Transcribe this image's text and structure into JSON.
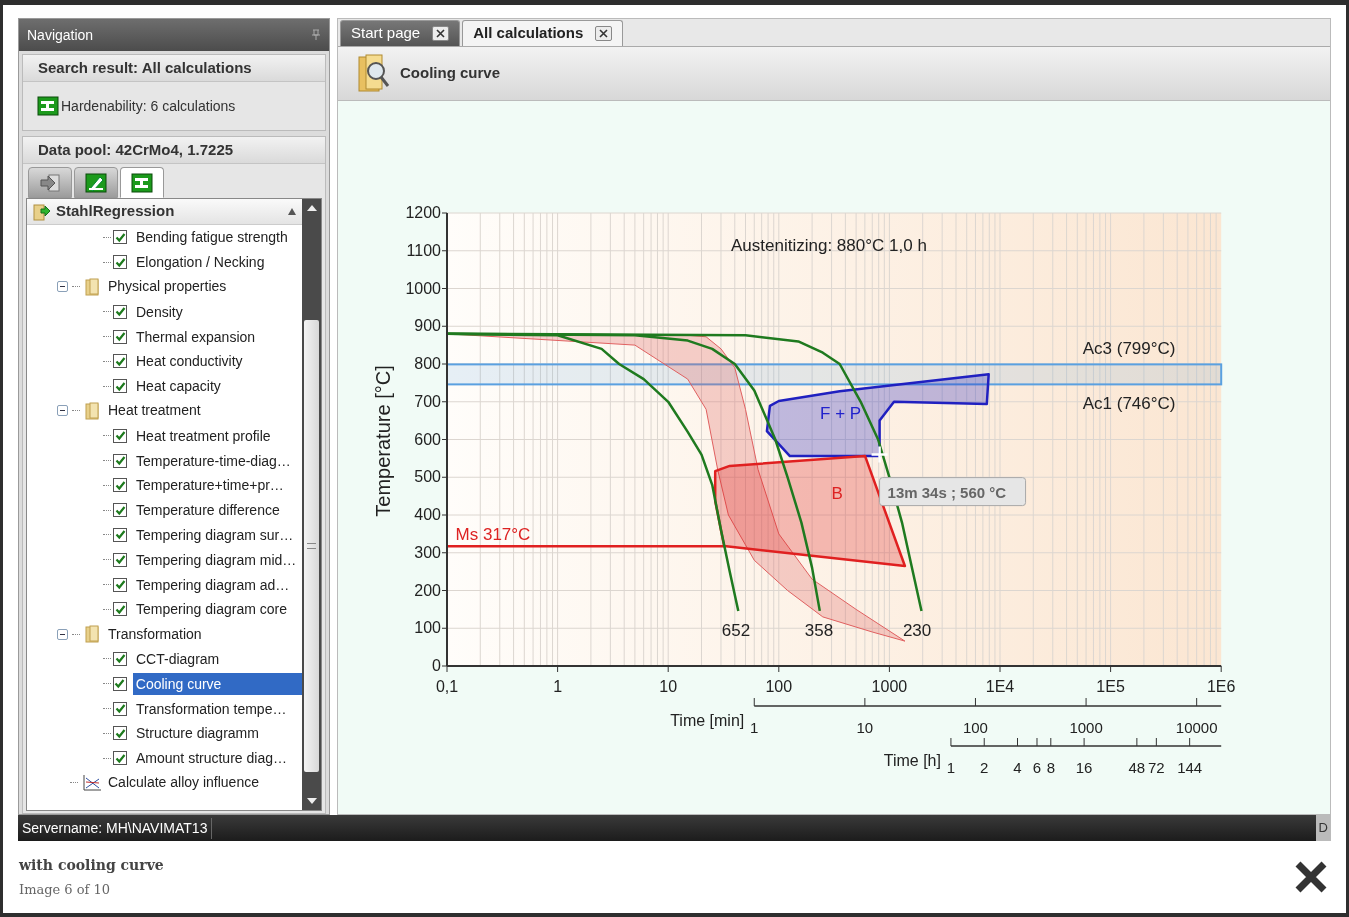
{
  "navigation": {
    "title": "Navigation",
    "search_result": {
      "title": "Search result: All calculations",
      "items": [
        {
          "label": "Hardenability: 6 calculations"
        }
      ]
    },
    "data_pool": {
      "title": "Data pool: 42CrMo4, 1.7225",
      "tabs": [
        {
          "kind": "import",
          "selected": false
        },
        {
          "kind": "edit",
          "selected": false
        },
        {
          "kind": "profile",
          "selected": true
        }
      ]
    },
    "tree": {
      "root": {
        "label": "StahlRegression",
        "expanded": true
      },
      "items": [
        {
          "kind": "group",
          "children": [
            {
              "kind": "check",
              "label": "Bending fatigue strength",
              "checked": true,
              "selected": false
            },
            {
              "kind": "check",
              "label": "Elongation / Necking",
              "checked": true,
              "selected": false
            }
          ]
        },
        {
          "kind": "folder",
          "label": "Physical properties",
          "expanded": true,
          "children": [
            {
              "kind": "check",
              "label": "Density",
              "checked": true,
              "selected": false
            },
            {
              "kind": "check",
              "label": "Thermal expansion",
              "checked": true,
              "selected": false
            },
            {
              "kind": "check",
              "label": "Heat conductivity",
              "checked": true,
              "selected": false
            },
            {
              "kind": "check",
              "label": "Heat capacity",
              "checked": true,
              "selected": false
            }
          ]
        },
        {
          "kind": "folder",
          "label": "Heat treatment",
          "expanded": true,
          "children": [
            {
              "kind": "check",
              "label": "Heat treatment profile",
              "checked": true,
              "selected": false
            },
            {
              "kind": "check",
              "label": "Temperature-time-diag…",
              "checked": true,
              "selected": false
            },
            {
              "kind": "check",
              "label": "Temperature+time+pr…",
              "checked": true,
              "selected": false
            },
            {
              "kind": "check",
              "label": "Temperature difference",
              "checked": true,
              "selected": false
            },
            {
              "kind": "check",
              "label": "Tempering diagram sur…",
              "checked": true,
              "selected": false
            },
            {
              "kind": "check",
              "label": "Tempering diagram mid…",
              "checked": true,
              "selected": false
            },
            {
              "kind": "check",
              "label": "Tempering diagram ad…",
              "checked": true,
              "selected": false
            },
            {
              "kind": "check",
              "label": "Tempering diagram core",
              "checked": true,
              "selected": false
            }
          ]
        },
        {
          "kind": "folder",
          "label": "Transformation",
          "expanded": true,
          "children": [
            {
              "kind": "check",
              "label": "CCT-diagram",
              "checked": true,
              "selected": false
            },
            {
              "kind": "check",
              "label": "Cooling curve",
              "checked": true,
              "selected": true
            },
            {
              "kind": "check",
              "label": "Transformation tempe…",
              "checked": true,
              "selected": false
            },
            {
              "kind": "check",
              "label": "Structure diagramm",
              "checked": true,
              "selected": false
            },
            {
              "kind": "check",
              "label": "Amount structure diag…",
              "checked": true,
              "selected": false
            }
          ]
        },
        {
          "kind": "action",
          "label": "Calculate alloy influence"
        }
      ]
    }
  },
  "tabs": [
    {
      "label": "Start page",
      "selected": false
    },
    {
      "label": "All calculations",
      "selected": true
    }
  ],
  "page_title": "Cooling curve",
  "diagram": {
    "ylabel": "Temperature [°C]",
    "yticks": [
      "1200",
      "1100",
      "1000",
      "900",
      "800",
      "700",
      "600",
      "500",
      "400",
      "300",
      "200",
      "100",
      "0"
    ],
    "xticks": [
      "0,1",
      "1",
      "10",
      "100",
      "1000",
      "1E4",
      "1E5",
      "1E6"
    ],
    "time_axes": [
      {
        "label": "Time [min]",
        "ticks": [
          "1",
          "10",
          "100",
          "1000",
          "10000"
        ]
      },
      {
        "label": "Time [h]",
        "ticks": [
          "1",
          "2",
          "4",
          "6",
          "8",
          "16",
          "48",
          "72",
          "144"
        ]
      }
    ],
    "notes": [
      {
        "text": "Austenitizing: 880°C 1,0 h",
        "color": "#222222"
      },
      {
        "text": "Ac3 (799°C)",
        "color": "#222222"
      },
      {
        "text": "Ac1 (746°C)",
        "color": "#222222"
      },
      {
        "text": "F + P",
        "color": "#2222cc"
      },
      {
        "text": "B",
        "color": "#dd2222"
      },
      {
        "text": "Ms 317°C",
        "color": "#dd2222"
      }
    ],
    "curve_labels": [
      "652",
      "358",
      "230"
    ],
    "tooltip": "13m 34s ; 560 °C"
  },
  "status_bar": {
    "server": "Servername: MH\\NAVIMAT13",
    "button": "D"
  },
  "caption": {
    "title": "with cooling curve",
    "counter": "Image 6 of 10"
  }
}
